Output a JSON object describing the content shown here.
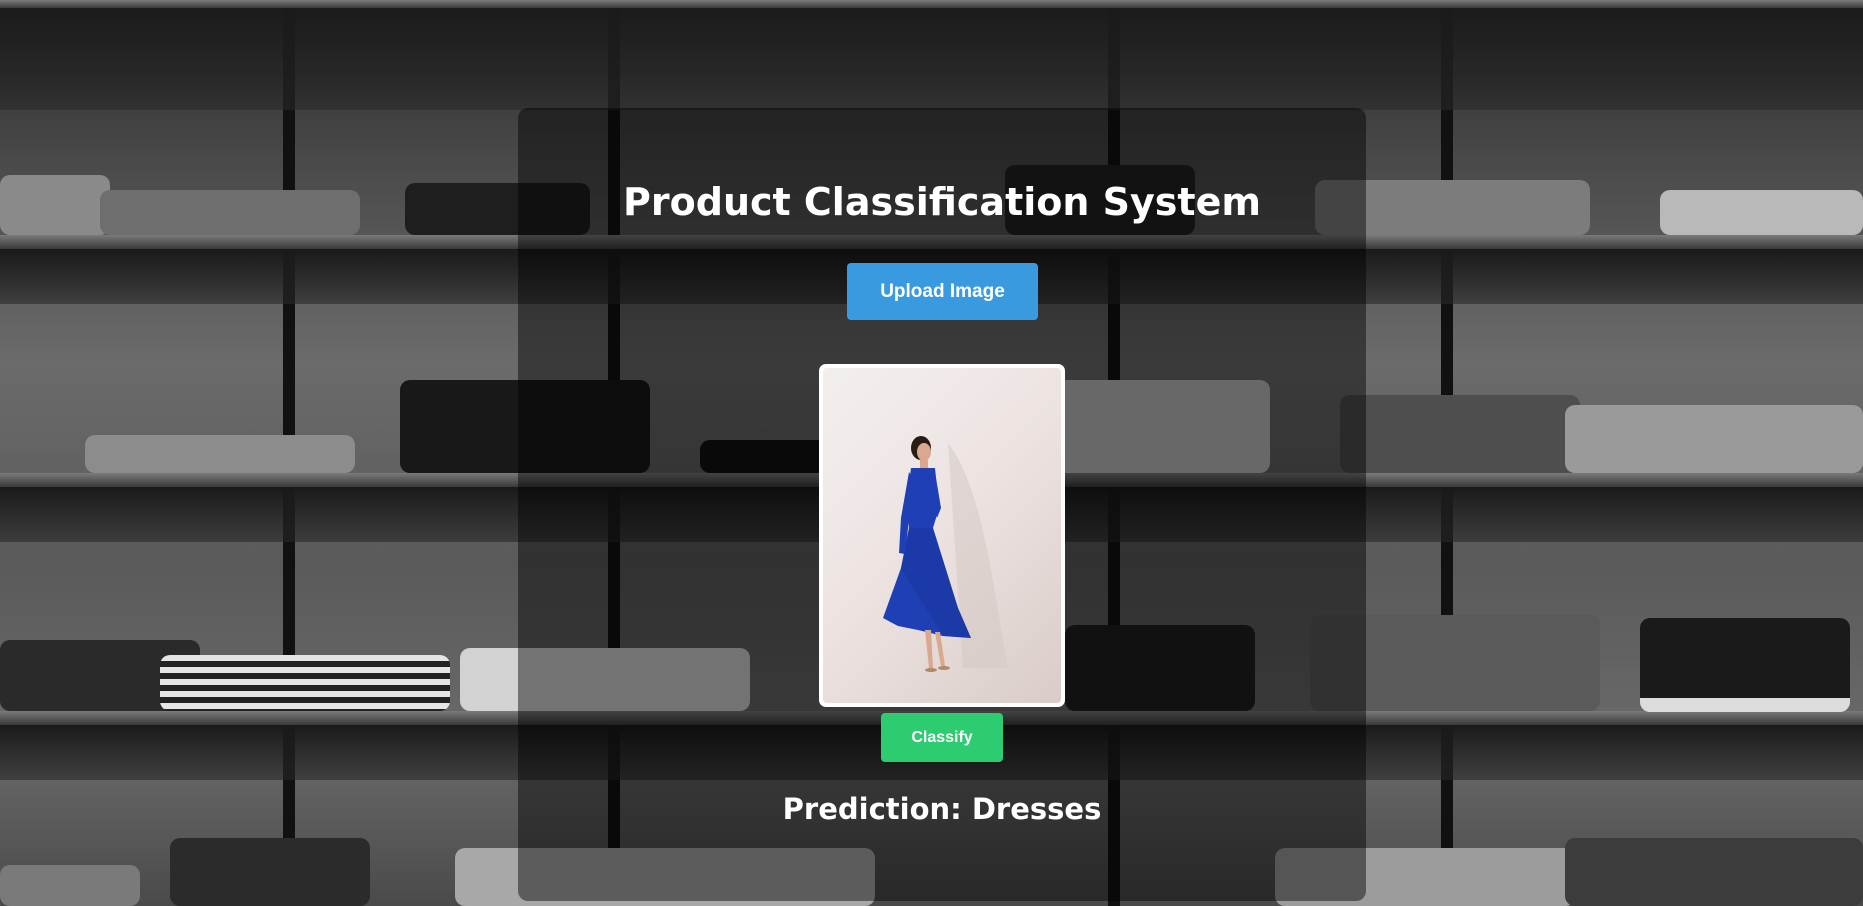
{
  "page": {
    "title": "Product Classification System"
  },
  "upload": {
    "label": "Upload Image"
  },
  "preview": {
    "description_icon": "dress-photo-icon"
  },
  "classify": {
    "label": "Classify"
  },
  "result": {
    "prefix": "Prediction: ",
    "value": "Dresses",
    "text": "Prediction: Dresses"
  },
  "colors": {
    "upload_button": "#3a9ae0",
    "classify_button": "#2ecc71",
    "panel_overlay": "rgba(0,0,0,0.45)",
    "dress": "#1f3fb5"
  }
}
